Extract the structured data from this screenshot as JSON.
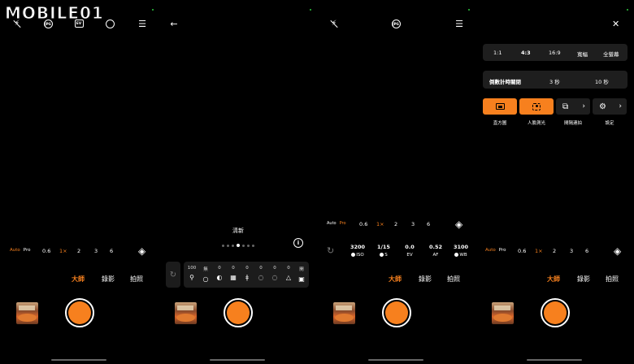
{
  "watermark": {
    "text": "MOBILE01"
  },
  "colors": {
    "accent": "#f7801e",
    "background": "#000000",
    "panel": "#1e1e1e"
  },
  "icons": {
    "flash": "⚡",
    "menu": "☰",
    "back": "←",
    "close": "✕",
    "layers": "◈",
    "rotate": "↻",
    "info": "ⓘ",
    "chevron": "›",
    "gear": "⚙"
  },
  "top_bar": {
    "jpg_label": "JPG",
    "ev_label": "EV"
  },
  "zoom": {
    "auto": "Auto",
    "pro": "Pro",
    "levels": [
      "0.6",
      "1×",
      "2",
      "3",
      "6"
    ]
  },
  "modes": {
    "master": "大師",
    "video": "錄影",
    "photo": "拍照"
  },
  "filter": {
    "name": "清新",
    "values": [
      "100",
      "無",
      "0",
      "0",
      "0",
      "0",
      "0",
      "0",
      "開"
    ]
  },
  "pro_settings": [
    {
      "value": "3200",
      "label": "ISO"
    },
    {
      "value": "1/15",
      "label": "S"
    },
    {
      "value": "0.0",
      "label": "EV"
    },
    {
      "value": "0.52",
      "label": "AF"
    },
    {
      "value": "3100",
      "label": "WB"
    }
  ],
  "settings": {
    "ratios": [
      "1:1",
      "4:3",
      "16:9",
      "寬幅",
      "全螢幕"
    ],
    "timer_label": "倒數計時關閉",
    "timer_options": [
      "3 秒",
      "10 秒"
    ],
    "buttons": [
      "直方圖",
      "人臉測光",
      "間隔連拍",
      "設定"
    ]
  }
}
